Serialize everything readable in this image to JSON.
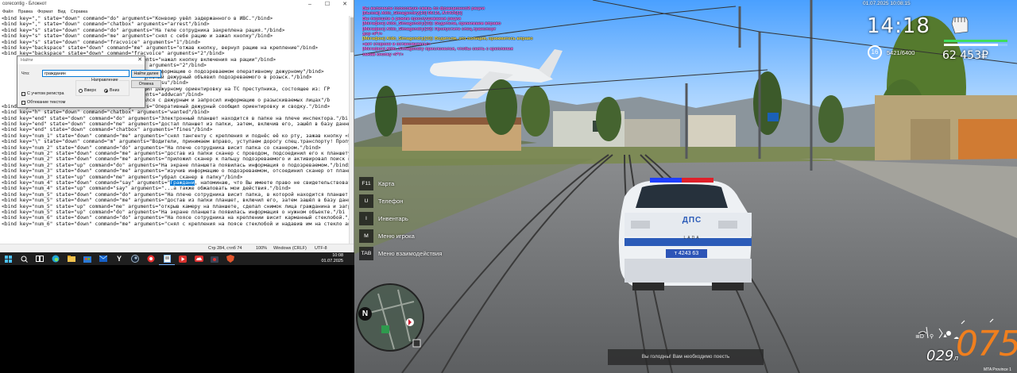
{
  "notepad": {
    "title": "corecontig - Блокнот",
    "controls": [
      "–",
      "☐",
      "✕"
    ],
    "menu": [
      "Файл",
      "Правка",
      "Формат",
      "Вид",
      "Справка"
    ],
    "lines": [
      "<bind key=\",\" state=\"down\" command=\"do\" arguments=\"Конвоир увёл задержанного в ИВС.\"/bind>",
      "<bind key=\",\" state=\"down\" command=\"chatbox\" arguments=\"arrest\"/bind>",
      "<bind key=\"s\" state=\"down\" command=\"do\" arguments=\"На теле сотрудника закреплена рация.\"/bind>",
      "<bind key=\"s\" state=\"down\" command=\"me\" arguments=\"снял с себя рацию и зажал кнопку\"/bind>",
      "<bind key=\"s\" state=\"down\" command=\"fracvoice\" arguments=\"1\"/bind>",
      "<bind key=\"backspace\" state=\"down\" command=\"me\" arguments=\"отжав кнопку, вернул рацию на крепление\"/bind>",
      "<bind key=\"backspace\" state=\"down\" command=\"fracvoice\" arguments=\"2\"/bind>",
      "                                          arguments=\"нажал кнопку включения на рации\"/bind>",
      "                                          voice\" arguments=\"2\"/bind>",
      "                                          \"передал информацию о подозреваемом оперативному дежурному\"/bind>",
      "                                          \"Оперативный дежурный объявил подозреваемого в розыск.\"/bind>",
      "                                          arguments=\"su\"/bind>",
      "                                          \"сообщил дежурному ориентировку на ТС преступника, состоящее из: ГР",
      "                                          arguments=\"addwcan\"/bind>",
      "                                          \"связался с дежурным и запросил информацию о разыскиваемых лицах\"/b",
      "<bind key=\"h\" state=\"down\" command=\"do\" arguments=\"Оперативный дежурный сообщил ориентировку и сводку.\"/bind>",
      "<bind key=\"h\" state=\"down\" command=\"chatbox\" arguments=\"wanted\"/bind>",
      "<bind key=\"end\" state=\"down\" command=\"do\" arguments=\"Электронный планшет находится в папке на плече инспектора.\"/bi",
      "<bind key=\"end\" state=\"down\" command=\"me\" arguments=\"достал планшет из папки, затем, включив его, зашёл в базу данных",
      "<bind key=\"end\" state=\"down\" command=\"chatbox\" arguments=\"fines\"/bind>",
      "<bind key=\"num_1\" state=\"down\" command=\"me\" arguments=\"снял тангенту с крепления и поднёс её ко рту, зажав кнопку «PT",
      "<bind key=\"\\\" state=\"down\" command=\"m\" arguments=\"Водители, принимаем вправо, уступаем дорогу спец.транспорту! Пропус",
      "<bind key=\"num_2\" state=\"down\" command=\"do\" arguments=\"На плече сотрудника висит папка со сканером.\"/bind>",
      "<bind key=\"num_2\" state=\"down\" command=\"me\" arguments=\"достав из папки сканер с проводом, подсоединил его к планшету\"/",
      "<bind key=\"num_2\" state=\"down\" command=\"me\" arguments=\"приложил сканер к пальцу подозреваемого и активировал поиск в ба",
      "<bind key=\"num_2\" state=\"up\" command=\"do\" arguments=\"На экране планшета появилась информация о подозреваемом.\"/bind>",
      "<bind key=\"num_3\" state=\"down\" command=\"me\" arguments=\"изучив информацию о подозреваемом, отсоединил сканер от планше",
      "<bind key=\"num_3\" state=\"up\" command=\"me\" arguments=\"убрал сканер в папку\"/bind>",
      "<bind key=\"num_4\" state=\"down\" command=\"say\" arguments=\"|HL|, напоминаю, что Вы имеете право не свидетельствоват",
      "<bind key=\"num_4\" state=\"up\" command=\"say\" arguments=\"...а также обжаловать мои действия.\"/bind>",
      "<bind key=\"num_5\" state=\"down\" command=\"do\" arguments=\"На плече сотрудника висит папка, в которой находится планшет.\"",
      "<bind key=\"num_5\" state=\"down\" command=\"me\" arguments=\"достав из папки планшет, включил его, затем зашёл в базу данны",
      "<bind key=\"num_5\" state=\"up\" command=\"me\" arguments=\"открыв камеру на планшете, сделал снимок лица гражданина и загру",
      "<bind key=\"num_5\" state=\"up\" command=\"do\" arguments=\"На экране планшета появилась информация о нужном объекте.\"/bi",
      "<bind key=\"num_6\" state=\"down\" command=\"do\" arguments=\"На поясе сотрудника на креплении висит карманный стеклобой.\"/b",
      "<bind key=\"num_6\" state=\"down\" command=\"me\" arguments=\"снял с крепления на поясе стеклобой и надавив им на стекло авт"
    ],
    "highlight": "Граждани",
    "status": {
      "position": "Стр 284, стлб 74",
      "zoom": "100%",
      "eol": "Windows (CRLF)",
      "encoding": "UTF-8"
    }
  },
  "find_dialog": {
    "title": "Найти",
    "label": "Что:",
    "value": "гражданин",
    "find_next": "Найти далее",
    "cancel": "Отмена",
    "direction": "Направление",
    "up": "Вверх",
    "down": "Вниз",
    "match_case": "С учетом регистра",
    "wrap": "Обтекание текстом"
  },
  "taskbar": {
    "time": "10:08",
    "date": "01.07.2025"
  },
  "game": {
    "chat": [
      {
        "text": "Вы включили голосовую связь по фракционной рации",
        "color": "#ff6ef2"
      },
      {
        "text": "[Вызов] Aldo_Simagendry[10] 06:15, АТПО6[3]",
        "color": "#ff6ef2"
      },
      {
        "text": "Вы перешли в режим прослушивания рации",
        "color": "#ff6ef2"
      },
      {
        "text": "[Мегафон] Aldo_Simagendry(10): Водители, принимаем вправо",
        "color": "#ff6ef2"
      },
      {
        "text": "[Мегафон] Aldo_Simagendry(10): Пропустите спец.транспорт",
        "color": "#ff6ef2"
      },
      {
        "text": "дор «РТ»",
        "color": "#ff6ef2"
      },
      {
        "text": "[Мегафон] Aldo_Simagendry[10]: Водители, это полиция, прижмитесь вправо",
        "color": "#ffe14a"
      },
      {
        "text": "«вет стороне и остановитесь!»",
        "color": "#ff6ef2"
      },
      {
        "text": "[Мегафон] Aldo_Simagendry прислонился, чтобы снять с крепления",
        "color": "#ff6ef2"
      },
      {
        "text": "зажав кнопку «РТ»",
        "color": "#ff6ef2"
      }
    ],
    "datetime": "01.07.2025 10:08:15",
    "time": "14:18",
    "level": "16",
    "exp": "5421/6400",
    "money": "62 453₽",
    "health_pct": 100,
    "armor_pct": 85,
    "colors": {
      "health": "#3fdc5d",
      "armor": "#ffffff"
    },
    "menu": [
      {
        "key": "F11",
        "label": "Карта"
      },
      {
        "key": "U",
        "label": "Телефон"
      },
      {
        "key": "I",
        "label": "Инвентарь"
      },
      {
        "key": "M",
        "label": "Меню игрока"
      },
      {
        "key": "TAB",
        "label": "Меню взаимодействия"
      }
    ],
    "car_text": "ДПС",
    "car_brand": "LADA",
    "plate": "т 4243 63",
    "compass": "N",
    "hunger": "Вы голодны! Вам необходимо поесть",
    "fuel": "029",
    "fuel_unit": "л",
    "speed": "075",
    "server": "MTA Province 1"
  }
}
